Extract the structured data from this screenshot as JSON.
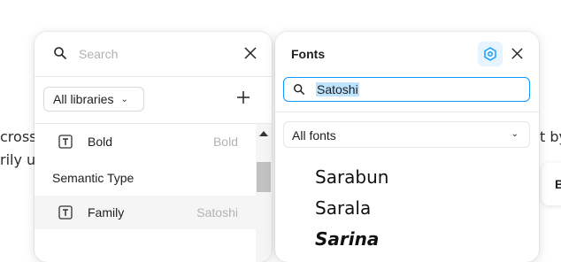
{
  "background": {
    "text_line_1_left": "cross",
    "text_line_2_left": "rily us",
    "text_line_1_right": "t by",
    "stub_letter": "B"
  },
  "left_panel": {
    "search_placeholder": "Search",
    "library_dropdown": "All libraries",
    "items": [
      {
        "name": "Bold",
        "meta": "Bold",
        "icon": "text-style-icon"
      },
      {
        "name": "Family",
        "meta": "Satoshi",
        "icon": "text-style-icon"
      }
    ],
    "section_heading": "Semantic Type"
  },
  "right_panel": {
    "title": "Fonts",
    "search_value": "Satoshi",
    "filter_value": "All fonts",
    "font_previews": [
      "Sarabun",
      "Sarala",
      "Sarina"
    ]
  },
  "colors": {
    "accent": "#0d99ff",
    "accent_light": "#e5f4ff",
    "selection": "#bde3ff"
  }
}
